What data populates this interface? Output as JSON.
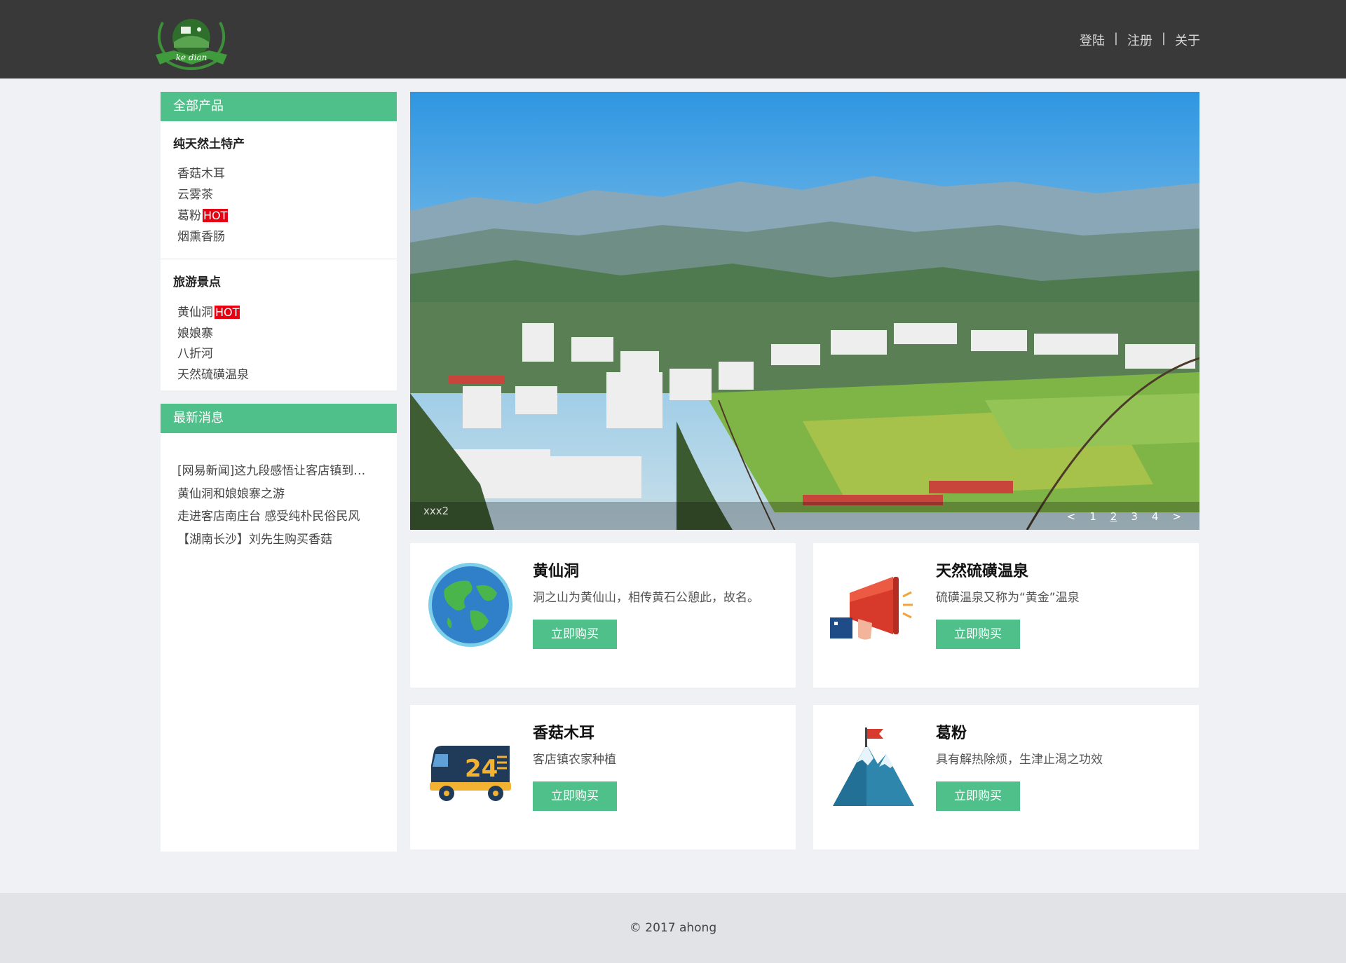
{
  "header": {
    "logo_text": "ke dian",
    "nav": [
      {
        "label": "登陆"
      },
      {
        "label": "注册"
      },
      {
        "label": "关于"
      }
    ],
    "separator": "|"
  },
  "sidebar": {
    "products_title": "全部产品",
    "groups": [
      {
        "title": "纯天然土特产",
        "items": [
          {
            "label": "香菇木耳",
            "hot": ""
          },
          {
            "label": "云雾茶",
            "hot": ""
          },
          {
            "label": "葛粉",
            "hot": "HOT"
          },
          {
            "label": "烟熏香肠",
            "hot": ""
          }
        ]
      },
      {
        "title": "旅游景点",
        "items": [
          {
            "label": "黄仙洞",
            "hot": "HOT"
          },
          {
            "label": "娘娘寨",
            "hot": ""
          },
          {
            "label": "八折河",
            "hot": ""
          },
          {
            "label": "天然硫磺温泉",
            "hot": ""
          }
        ]
      }
    ],
    "news_title": "最新消息",
    "news": [
      "[网易新闻]这九段感悟让客店镇到…",
      "黄仙洞和娘娘寨之游",
      "走进客店南庄台 感受纯朴民俗民风",
      "【湖南长沙】刘先生购买香菇"
    ]
  },
  "banner": {
    "caption": "xxx2",
    "prev": "<",
    "next": ">",
    "pages": [
      "1",
      "2",
      "3",
      "4"
    ],
    "active_page": "2"
  },
  "cards": [
    {
      "title": "黄仙洞",
      "desc": "洞之山为黄仙山，相传黄石公憩此，故名。",
      "button": "立即购买",
      "icon": "globe-icon"
    },
    {
      "title": "天然硫磺温泉",
      "desc": "硫磺温泉又称为“黄金”温泉",
      "button": "立即购买",
      "icon": "megaphone-icon"
    },
    {
      "title": "香菇木耳",
      "desc": "客店镇农家种植",
      "button": "立即购买",
      "icon": "delivery-truck-icon"
    },
    {
      "title": "葛粉",
      "desc": "具有解热除烦，生津止渴之功效",
      "button": "立即购买",
      "icon": "mountain-flag-icon"
    }
  ],
  "footer": {
    "copyright": "© 2017 ahong"
  },
  "colors": {
    "accent": "#50c08b",
    "topbar": "#393939",
    "hot": "#e60012"
  }
}
